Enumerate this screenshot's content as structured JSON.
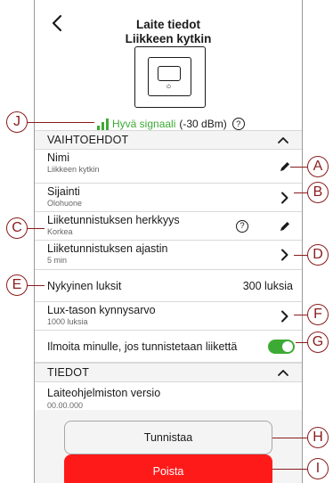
{
  "header": {
    "title_line1": "Laite tiedot",
    "title_line2": "Liikkeen kytkin"
  },
  "signal": {
    "status": "Hyvä signaali",
    "strength": "(-30 dBm)",
    "help": "?"
  },
  "sections": {
    "options": "VAIHTOEHDOT",
    "info": "TIEDOT"
  },
  "settings": {
    "name": {
      "label": "Nimi",
      "value": "Liikkeen kytkin"
    },
    "location": {
      "label": "Sijainti",
      "value": "Olohuone"
    },
    "sensitivity": {
      "label": "Liiketunnistuksen herkkyys",
      "value": "Korkea",
      "help": "?"
    },
    "timer": {
      "label": "Liiketunnistuksen ajastin",
      "value": "5 min"
    },
    "current_lux": {
      "label": "Nykyinen luksit",
      "value": "300 luksia"
    },
    "lux_threshold": {
      "label": "Lux-tason kynnysarvo",
      "value": "1000 luksia"
    },
    "notify": {
      "label": "Ilmoita minulle, jos tunnistetaan liikettä",
      "enabled": true
    }
  },
  "info": {
    "firmware": {
      "label": "Laiteohjelmiston versio",
      "value": "00.00.000"
    }
  },
  "buttons": {
    "identify": "Tunnistaa",
    "delete": "Poista"
  },
  "callouts": [
    "A",
    "B",
    "C",
    "D",
    "E",
    "F",
    "G",
    "H",
    "I",
    "J"
  ],
  "colors": {
    "accent_green": "#3daa35",
    "delete_red": "#ff1a1a",
    "callout": "#8a1c1c"
  }
}
